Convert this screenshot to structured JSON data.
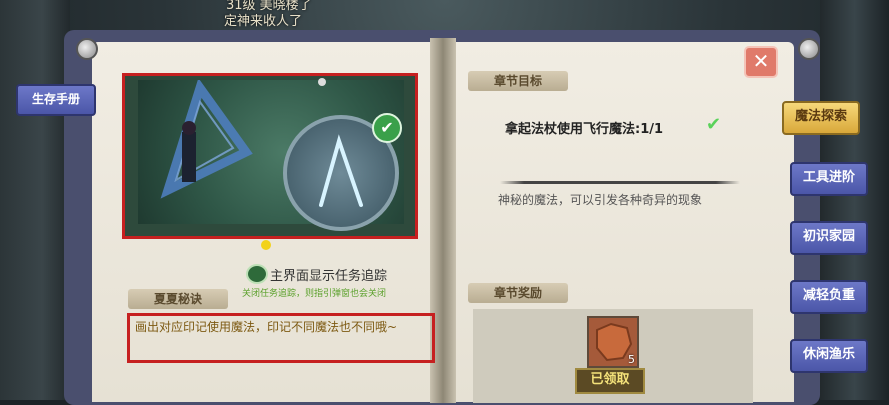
{
  "npc_bubble": {
    "line1": "31级 美晓楼了",
    "line2": "定神来收人了"
  },
  "left_tab": {
    "label": "生存手册"
  },
  "tracking": {
    "label": "主界面显示任务追踪",
    "note": "关闭任务追踪，则指引弹窗也会关闭"
  },
  "tips": {
    "header": "夏夏秘诀",
    "text": "画出对应印记使用魔法，印记不同魔法也不同哦~"
  },
  "chapter_goal": {
    "header": "章节目标",
    "objective": "拿起法杖使用飞行魔法:1/1",
    "description": "神秘的魔法，可以引发各种奇异的现象"
  },
  "rewards": {
    "header": "章节奖励",
    "item_count": "5",
    "claimed_label": "已领取"
  },
  "right_tabs": [
    {
      "label": "魔法探索",
      "active": true
    },
    {
      "label": "工具进阶",
      "active": false
    },
    {
      "label": "初识家园",
      "active": false
    },
    {
      "label": "减轻负重",
      "active": false
    },
    {
      "label": "休闲渔乐",
      "active": false
    }
  ],
  "close": {
    "symbol": "✕"
  },
  "check_symbol": "✔"
}
